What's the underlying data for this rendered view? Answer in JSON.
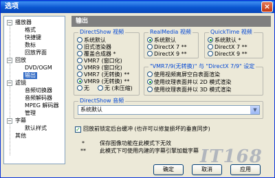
{
  "window": {
    "title": "选项",
    "close_icon": "close-icon"
  },
  "tree": {
    "items": [
      {
        "label": "播放器",
        "level": 0,
        "expander": "-"
      },
      {
        "label": "格式",
        "level": 1
      },
      {
        "label": "快捷键",
        "level": 1
      },
      {
        "label": "数标",
        "level": 1
      },
      {
        "label": "回放界面",
        "level": 1
      },
      {
        "label": "回放",
        "level": 0,
        "expander": "-"
      },
      {
        "label": "DVD/OGM",
        "level": 1
      },
      {
        "label": "输出",
        "level": 1,
        "selected": true
      },
      {
        "label": "滤镜",
        "level": 0,
        "expander": "-"
      },
      {
        "label": "音频切换器",
        "level": 1
      },
      {
        "label": "音频解码器",
        "level": 1
      },
      {
        "label": "MPEG 解码器",
        "level": 1
      },
      {
        "label": "管理",
        "level": 1
      },
      {
        "label": "字幕",
        "level": 0,
        "expander": "-"
      },
      {
        "label": "默认样式",
        "level": 1
      },
      {
        "label": "其他",
        "level": 0
      }
    ]
  },
  "panel": {
    "header": "输出"
  },
  "directshow_video": {
    "title": "DirectShow 视频",
    "options": [
      "系统默认",
      "旧式渲染器",
      "覆盖合成器 *",
      "VMR7 (窗口化)",
      "VMR9 (窗口化)",
      "VMR7 (无转换) **",
      "VMR9 (无转换) **"
    ],
    "selected": 6,
    "extra": [
      "无",
      "无 (未压缩)"
    ]
  },
  "realmedia_video": {
    "title": "RealMedia 视频",
    "options": [
      "系统默认",
      "DirectX 7 **",
      "DirectX 9 **"
    ],
    "selected": 0
  },
  "quicktime_video": {
    "title": "QuickTime 视频",
    "options": [
      "系统默认 *",
      "DirectX 7 **",
      "DirectX 9 **"
    ],
    "selected": 0
  },
  "vmr_settings": {
    "title": "\"VMR7/9(无转换)\" 与 \"DirectX 7/9\" 设定",
    "options": [
      "使用视频离屏空白表面渲染",
      "使用纹理表面并以 2D 模式渲染",
      "使用纹理表面并以 3D 模式渲染"
    ],
    "selected": 1
  },
  "directshow_audio": {
    "title": "DirectShow 音频",
    "value": "系统默认"
  },
  "checkbox": {
    "label": "回放前锁定后台缓冲 (也许可以修复损坏的垂直同步)",
    "checked": true
  },
  "notes": [
    {
      "mark": "*",
      "text": "保存图像功能在此模式下无效"
    },
    {
      "mark": "**",
      "text": "此模式下可使用内建的字幕引擎加载字幕"
    }
  ],
  "buttons": {
    "ok": "确定",
    "cancel": "取消",
    "apply": "应用"
  },
  "watermark": "IT168"
}
